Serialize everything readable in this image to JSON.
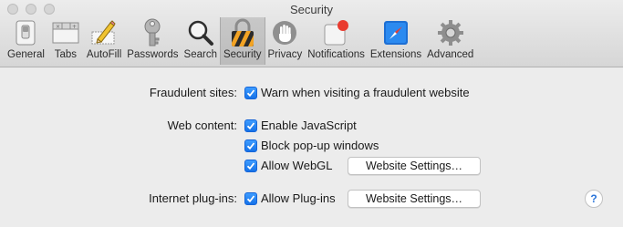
{
  "window": {
    "title": "Security"
  },
  "toolbar": {
    "tabs": [
      {
        "label": "General",
        "icon": "switch-icon"
      },
      {
        "label": "Tabs",
        "icon": "tabs-icon"
      },
      {
        "label": "AutoFill",
        "icon": "pencil-form-icon"
      },
      {
        "label": "Passwords",
        "icon": "key-icon"
      },
      {
        "label": "Search",
        "icon": "magnifier-icon"
      },
      {
        "label": "Security",
        "icon": "lock-icon",
        "active": true
      },
      {
        "label": "Privacy",
        "icon": "hand-icon"
      },
      {
        "label": "Notifications",
        "icon": "notification-badge-icon"
      },
      {
        "label": "Extensions",
        "icon": "compass-icon"
      },
      {
        "label": "Advanced",
        "icon": "gear-icon"
      }
    ]
  },
  "security": {
    "fraudulent_sites_label": "Fraudulent sites:",
    "warn_fraudulent_label": "Warn when visiting a fraudulent website",
    "web_content_label": "Web content:",
    "enable_javascript_label": "Enable JavaScript",
    "block_popups_label": "Block pop-up windows",
    "allow_webgl_label": "Allow WebGL",
    "webgl_settings_button": "Website Settings…",
    "plugins_label": "Internet plug-ins:",
    "allow_plugins_label": "Allow Plug-ins",
    "plugins_settings_button": "Website Settings…",
    "help_button": "?"
  },
  "checkboxes": {
    "warn_fraudulent": true,
    "enable_javascript": true,
    "block_popups": true,
    "allow_webgl": true,
    "allow_plugins": true
  },
  "colors": {
    "checkbox_blue": "#1672e8",
    "help_blue": "#2a74d9"
  }
}
